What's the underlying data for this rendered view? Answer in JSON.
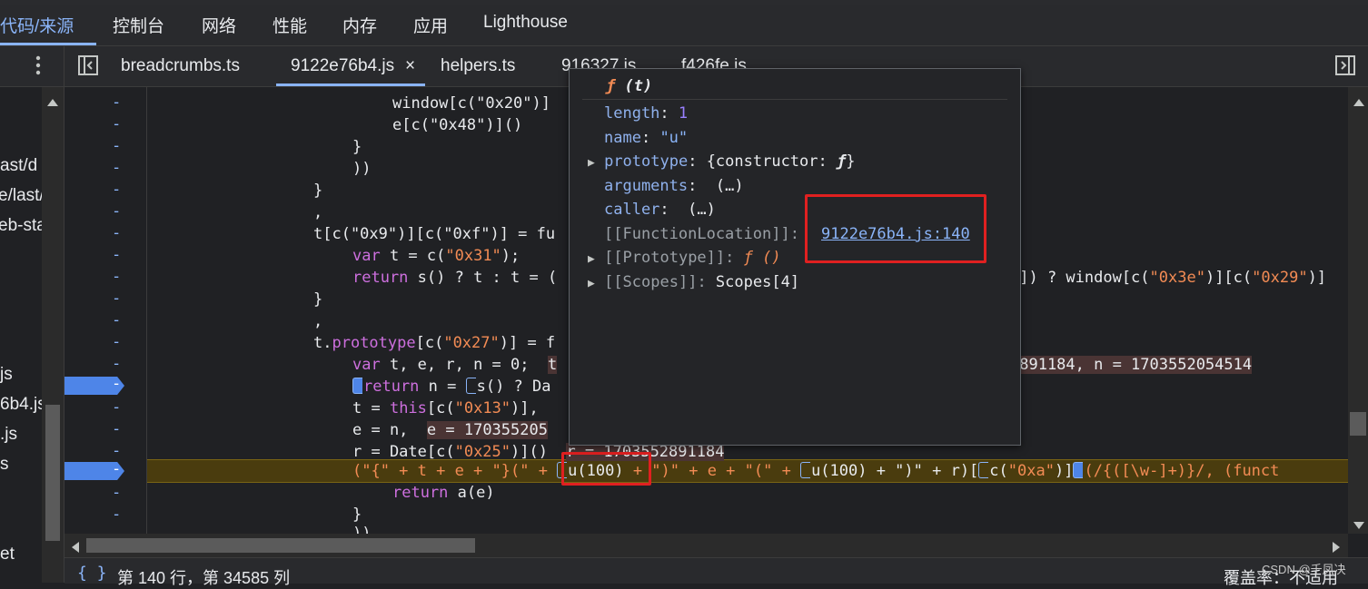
{
  "top_tabs": [
    {
      "label": "代码/来源",
      "active": true
    },
    {
      "label": "控制台"
    },
    {
      "label": "网络"
    },
    {
      "label": "性能"
    },
    {
      "label": "内存"
    },
    {
      "label": "应用"
    },
    {
      "label": "Lighthouse"
    }
  ],
  "file_tabs": [
    {
      "label": "breadcrumbs.ts"
    },
    {
      "label": "9122e76b4.js",
      "active": true,
      "close": "×"
    },
    {
      "label": "helpers.ts"
    },
    {
      "label": "916327.js"
    },
    {
      "label": "f426fe.js"
    }
  ],
  "navigator_items": [
    "ast/d",
    "e/last/",
    "eb-sta",
    "js",
    "6b4.js",
    ".js",
    "s",
    "et"
  ],
  "gutter_marks": [
    "-",
    "-",
    "-",
    "-",
    "-",
    "-",
    "-",
    "-",
    "-",
    "-",
    "-",
    "-",
    "-",
    "-",
    "-",
    "-",
    "-",
    "-",
    "-",
    "-"
  ],
  "code": {
    "l1": "window[c(\"0x20\")]",
    "l2": "e[c(\"0x48\")]()",
    "l3": "}",
    "l4": "))",
    "l5": "}",
    "l6": ",",
    "l7a": "t[c(\"0x9\")][c(\"0xf\")] = fu",
    "l8a": "var",
    "l8b": " t = c(",
    "l8c": "\"0x31\"",
    "l8d": ");",
    "l9a": "return",
    "l9b": " s() ? t : t = (",
    "l9c": ")]) ? window[c(",
    "l9d": "\"0x3e\"",
    "l9e": ")][c(",
    "l9f": "\"0x29\"",
    "l9g": ")]",
    "l10": "}",
    "l11": ",",
    "l12a": "t.",
    "l12b": "prototype",
    "l12c": "[c(",
    "l12d": "\"0x27\"",
    "l12e": ")] = f",
    "l13a": "var",
    "l13b": " t, e, r, n = 0;",
    "l13c": "t",
    "l13d": "2891184, n = 1703552054514",
    "l14a": "return",
    "l14b": " n = ",
    "l14c": "s() ? Da",
    "l15a": "t = ",
    "l15b": "this",
    "l15c": "[c(",
    "l15d": "\"0x13\"",
    "l15e": ")],",
    "l16a": "e = n,",
    "l16b": "e = 170355205",
    "l17a": "r = Date[c(",
    "l17b": "\"0x25\"",
    "l17c": ")]()",
    "l17d": "r = 1703552891184",
    "l18a": "(\"{\" + t + e + \"}(\" + ",
    "l18b": "u(100)",
    "l18c": " + \")\" + e + \"(\" + ",
    "l18d": "u(100) + \")\" + r)[",
    "l18e": "c(",
    "l18f": "\"0xa\"",
    "l18g": ")]",
    "l18h": "(/{([\\w-]+)}/, (funct",
    "l19a": "return",
    "l19b": " a(e)",
    "l20": "}",
    "l21": "))"
  },
  "popup": {
    "title_f": "ƒ",
    "title_rest": "(t)",
    "length_key": "length",
    "length_val": "1",
    "name_key": "name",
    "name_val": "\"u\"",
    "prototype_key": "prototype",
    "prototype_val_open": "{constructor: ",
    "prototype_val_f": "ƒ",
    "prototype_val_close": "}",
    "arguments_key": "arguments",
    "arguments_val": "(…)",
    "caller_key": "caller",
    "caller_val": "(…)",
    "fl_key": "[[FunctionLocation]]",
    "fl_val": "9122e76b4.js:140",
    "proto_key": "[[Prototype]]",
    "proto_val": "ƒ ()",
    "scopes_key": "[[Scopes]]",
    "scopes_val": "Scopes[4]"
  },
  "status": {
    "braces": "{ }",
    "position": "第 140 行，第 34585 列",
    "coverage": "覆盖率：不适用"
  },
  "watermark": "CSDN @千凤决",
  "colors": {
    "accent": "#8ab4f8",
    "breakpoint": "#4e85e8",
    "highlight_box": "#e02020",
    "exec_line": "#4a3c0e"
  }
}
